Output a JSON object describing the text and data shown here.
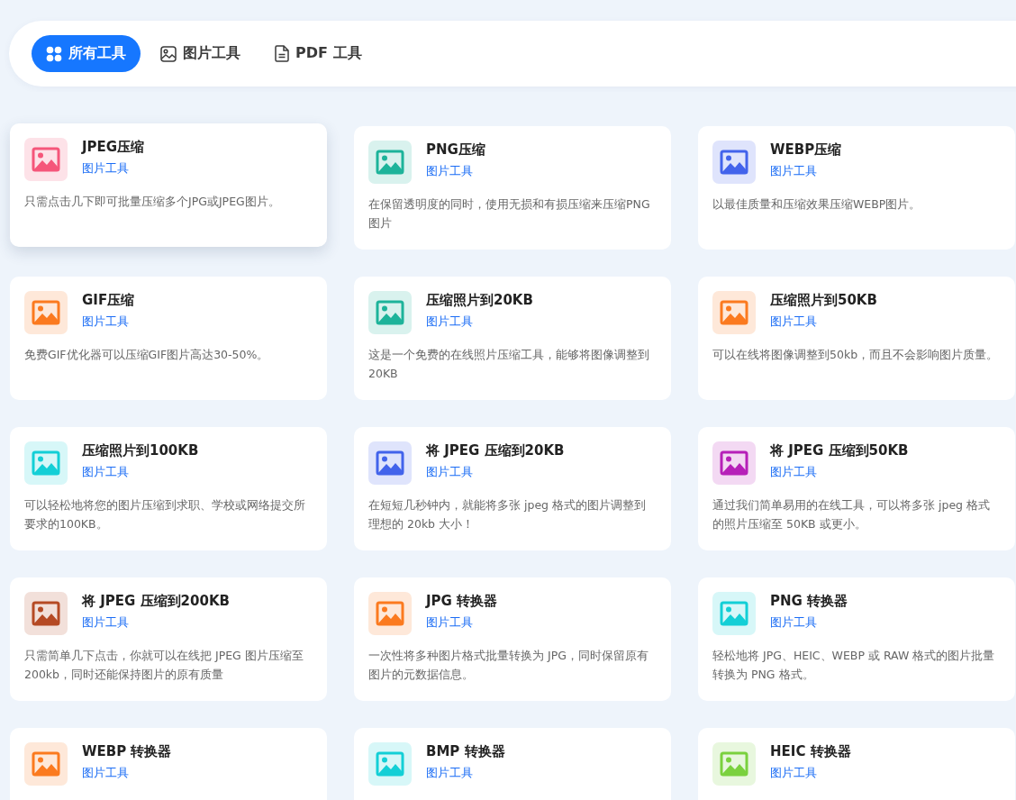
{
  "tabs": [
    {
      "label": "所有工具",
      "kind": "grid",
      "selected": true
    },
    {
      "label": "图片工具",
      "kind": "image",
      "selected": false
    },
    {
      "label": "PDF 工具",
      "kind": "document",
      "selected": false
    }
  ],
  "tools": [
    {
      "title": "JPEG压缩",
      "category": "图片工具",
      "description": "只需点击几下即可批量压缩多个JPG或JPEG图片。",
      "color": "#f5567a",
      "hovered": true
    },
    {
      "title": "PNG压缩",
      "category": "图片工具",
      "description": "在保留透明度的同时，使用无损和有损压缩来压缩PNG图片",
      "color": "#1db39a",
      "hovered": false
    },
    {
      "title": "WEBP压缩",
      "category": "图片工具",
      "description": "以最佳质量和压缩效果压缩WEBP图片。",
      "color": "#4263eb",
      "hovered": false
    },
    {
      "title": "GIF压缩",
      "category": "图片工具",
      "description": "免费GIF优化器可以压缩GIF图片高达30-50%。",
      "color": "#fb7a1f",
      "hovered": false
    },
    {
      "title": "压缩照片到20KB",
      "category": "图片工具",
      "description": "这是一个免费的在线照片压缩工具，能够将图像调整到20KB",
      "color": "#1db39a",
      "hovered": false
    },
    {
      "title": "压缩照片到50KB",
      "category": "图片工具",
      "description": "可以在线将图像调整到50kb，而且不会影响图片质量。",
      "color": "#fb7a1f",
      "hovered": false
    },
    {
      "title": "压缩照片到100KB",
      "category": "图片工具",
      "description": "可以轻松地将您的图片压缩到求职、学校或网络提交所要求的100KB。",
      "color": "#13cfd6",
      "hovered": false
    },
    {
      "title": "将 JPEG 压缩到20KB",
      "category": "图片工具",
      "description": "在短短几秒钟内，就能将多张 jpeg 格式的图片调整到理想的 20kb 大小！",
      "color": "#4263eb",
      "hovered": false
    },
    {
      "title": "将 JPEG 压缩到50KB",
      "category": "图片工具",
      "description": "通过我们简单易用的在线工具，可以将多张 jpeg 格式的照片压缩至 50KB 或更小。",
      "color": "#b620b8",
      "hovered": false
    },
    {
      "title": "将 JPEG 压缩到200KB",
      "category": "图片工具",
      "description": "只需简单几下点击，你就可以在线把 JPEG 图片压缩至 200kb，同时还能保持图片的原有质量",
      "color": "#b54a24",
      "hovered": false
    },
    {
      "title": "JPG 转换器",
      "category": "图片工具",
      "description": "一次性将多种图片格式批量转换为 JPG，同时保留原有图片的元数据信息。",
      "color": "#fb7a1f",
      "hovered": false
    },
    {
      "title": "PNG 转换器",
      "category": "图片工具",
      "description": "轻松地将 JPG、HEIC、WEBP 或 RAW 格式的图片批量转换为 PNG 格式。",
      "color": "#13cfd6",
      "hovered": false
    },
    {
      "title": "WEBP 转换器",
      "category": "图片工具",
      "color": "#fb7a1f",
      "hovered": false
    },
    {
      "title": "BMP 转换器",
      "category": "图片工具",
      "color": "#13cfd6",
      "hovered": false
    },
    {
      "title": "HEIC 转换器",
      "category": "图片工具",
      "color": "#7ad13e",
      "hovered": false
    }
  ]
}
